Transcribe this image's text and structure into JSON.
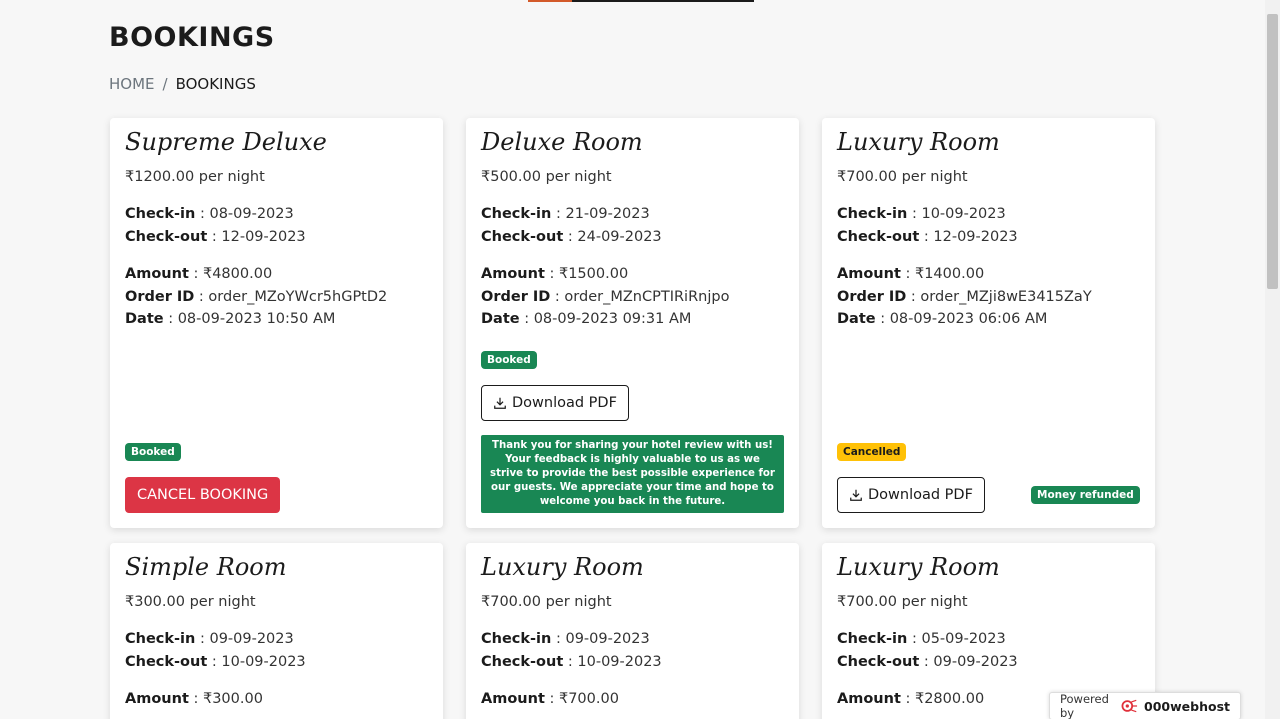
{
  "page": {
    "title": "BOOKINGS"
  },
  "breadcrumb": {
    "home": "HOME",
    "separator": "/",
    "current": "BOOKINGS"
  },
  "labels": {
    "checkin": "Check-in",
    "checkout": "Check-out",
    "amount": "Amount",
    "order_id": "Order ID",
    "date": "Date"
  },
  "cards": [
    {
      "title": "Supreme Deluxe",
      "price": "₹1200.00 per night",
      "checkin": " : 08-09-2023",
      "checkout": " : 12-09-2023",
      "amount": " : ₹4800.00",
      "order_id": " : order_MZoYWcr5hGPtD2",
      "date": " : 08-09-2023 10:50 AM",
      "status": "Booked",
      "action": "CANCEL BOOKING"
    },
    {
      "title": "Deluxe Room",
      "price": "₹500.00 per night",
      "checkin": " : 21-09-2023",
      "checkout": " : 24-09-2023",
      "amount": " : ₹1500.00",
      "order_id": " : order_MZnCPTIRiRnjpo",
      "date": " : 08-09-2023 09:31 AM",
      "status": "Booked",
      "action": "Download PDF",
      "review_message": "Thank you for sharing your hotel review with us! Your feedback is highly valuable to us as we strive to provide the best possible experience for our guests. We appreciate your time and hope to welcome you back in the future."
    },
    {
      "title": "Luxury Room",
      "price": "₹700.00 per night",
      "checkin": " : 10-09-2023",
      "checkout": " : 12-09-2023",
      "amount": " : ₹1400.00",
      "order_id": " : order_MZji8wE3415ZaY",
      "date": " : 08-09-2023 06:06 AM",
      "status": "Cancelled",
      "action": "Download PDF",
      "refund": "Money refunded"
    },
    {
      "title": "Simple Room",
      "price": "₹300.00 per night",
      "checkin": " : 09-09-2023",
      "checkout": " : 10-09-2023",
      "amount": " : ₹300.00"
    },
    {
      "title": "Luxury Room",
      "price": "₹700.00 per night",
      "checkin": " : 09-09-2023",
      "checkout": " : 10-09-2023",
      "amount": " : ₹700.00"
    },
    {
      "title": "Luxury Room",
      "price": "₹700.00 per night",
      "checkin": " : 05-09-2023",
      "checkout": " : 09-09-2023",
      "amount": " : ₹2800.00"
    }
  ],
  "footer": {
    "powered_by": "Powered by",
    "brand": "000webhost"
  },
  "colors": {
    "success": "#198754",
    "danger": "#dc3545",
    "warning": "#ffc107"
  },
  "icons": {
    "download": "download-icon",
    "brand_logo": "webhost-logo-icon"
  }
}
